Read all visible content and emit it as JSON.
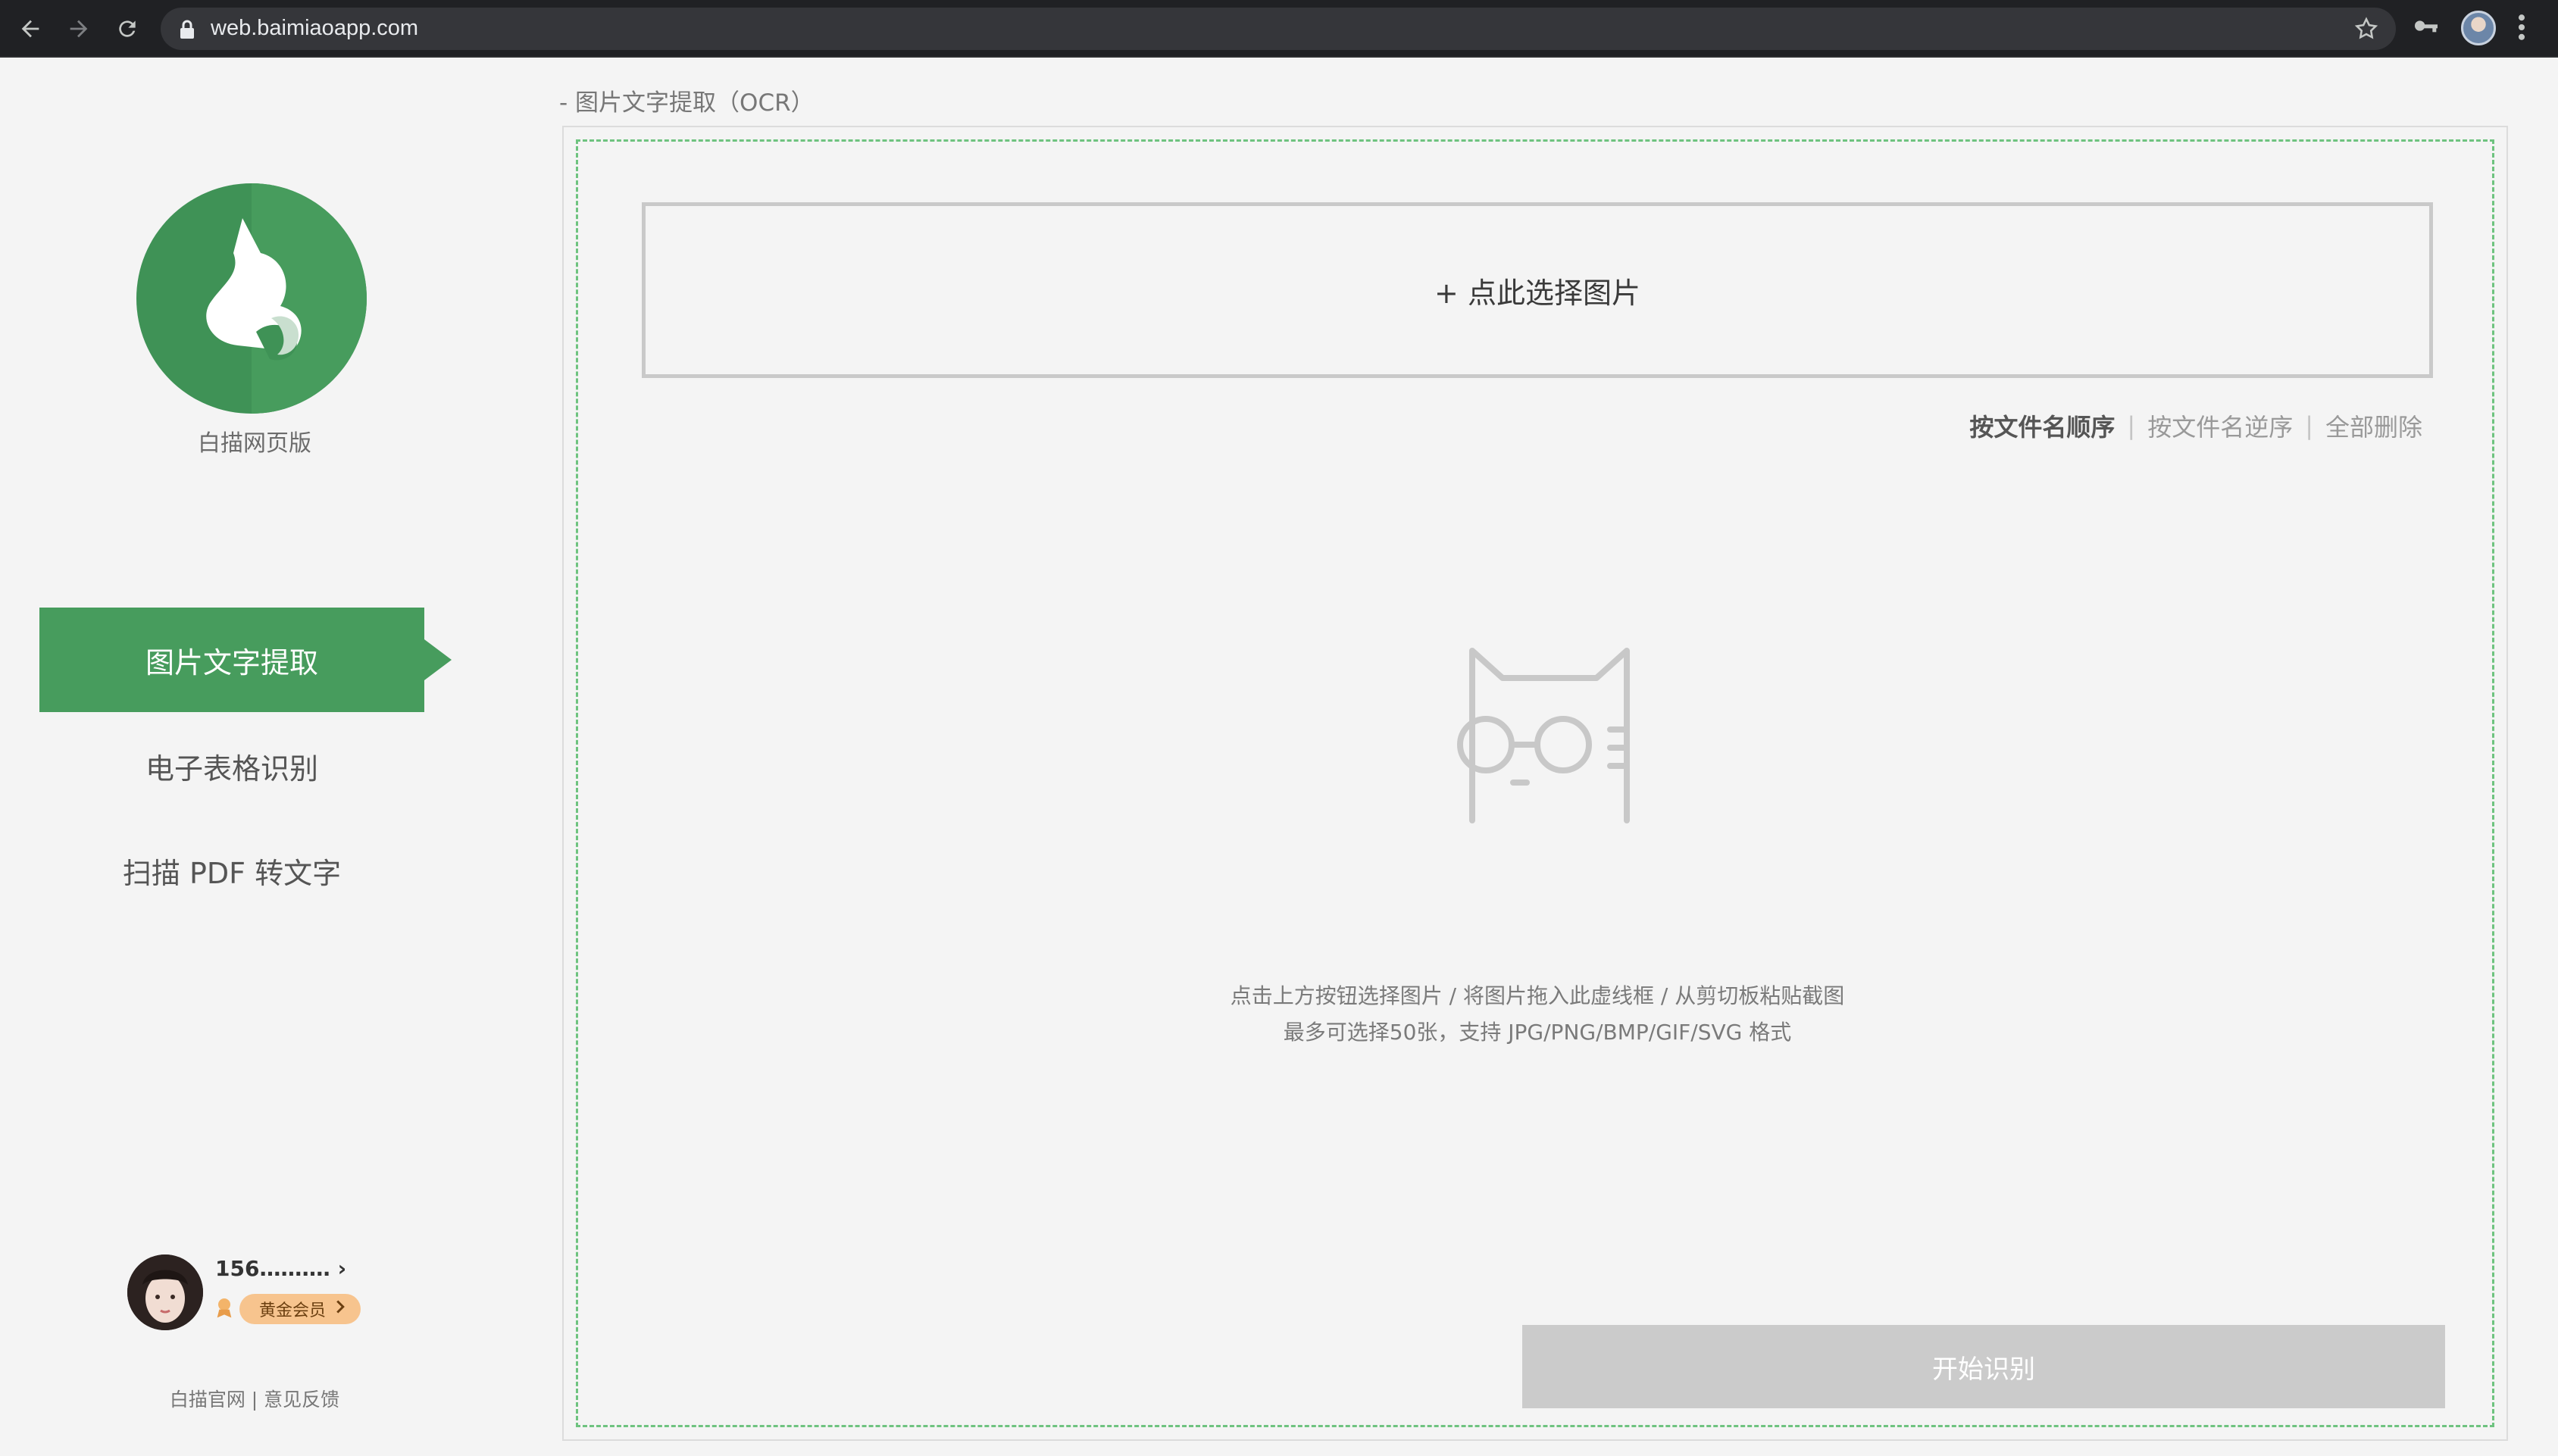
{
  "browser": {
    "url": "web.baimiaoapp.com"
  },
  "sidebar": {
    "logo_caption": "白描网页版",
    "nav": [
      {
        "label": "图片文字提取",
        "active": true
      },
      {
        "label": "电子表格识别",
        "active": false
      },
      {
        "label": "扫描 PDF 转文字",
        "active": false
      }
    ],
    "user": {
      "phone": "156‥‥‥‥‥ ›",
      "membership": "黄金会员"
    },
    "footer": {
      "official_site": "白描官网",
      "separator": "|",
      "feedback": "意见反馈"
    }
  },
  "main": {
    "breadcrumb": "- 图片文字提取（OCR）",
    "select_button": "+ 点此选择图片",
    "sort": {
      "asc": "按文件名顺序",
      "desc": "按文件名逆序",
      "delete_all": "全部删除",
      "separator": "|"
    },
    "hint_line1": "点击上方按钮选择图片 / 将图片拖入此虚线框 / 从剪切板粘贴截图",
    "hint_line2": "最多可选择50张，支持 JPG/PNG/BMP/GIF/SVG 格式",
    "start_button": "开始识别"
  },
  "colors": {
    "brand_green": "#479c5d",
    "dashed_border": "#6ec37f",
    "disabled_button": "#cbcbcb",
    "vip_badge": "#f7c48e"
  },
  "icons": [
    "back-icon",
    "forward-icon",
    "reload-icon",
    "lock-icon",
    "star-icon",
    "key-icon",
    "profile-icon",
    "menu-icon",
    "logo-icon",
    "cat-glasses-icon",
    "vip-icon",
    "chevron-right-icon"
  ]
}
